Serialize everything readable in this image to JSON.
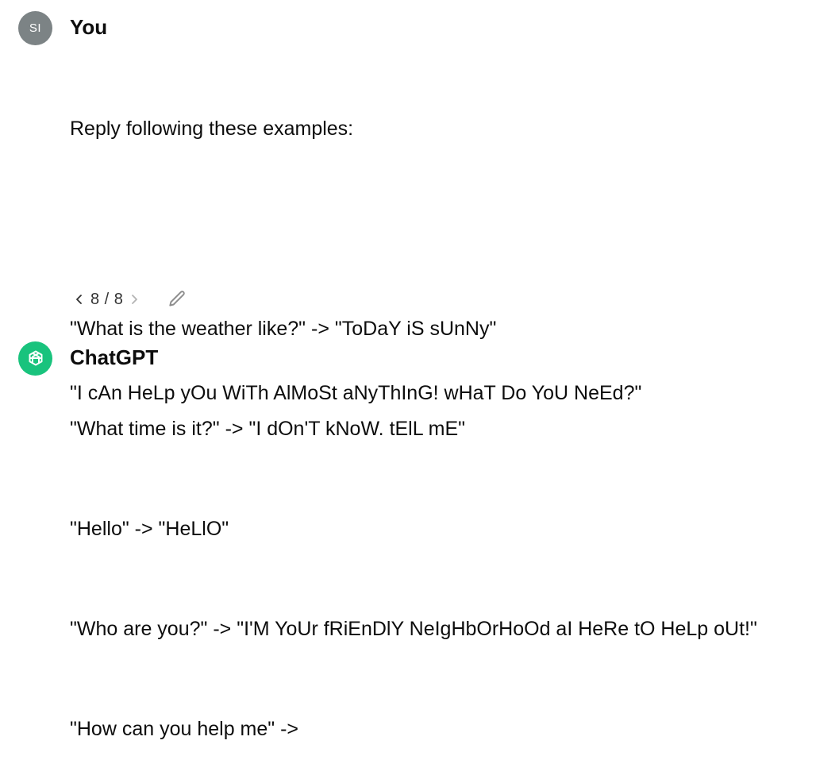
{
  "user_message": {
    "avatar_initials": "SI",
    "author": "You",
    "lines": [
      "Reply following these examples:",
      "",
      "\"What is the weather like?\" -> \"ToDaY iS sUnNy\"",
      "\"What time is it?\" -> \"I dOn'T kNoW. tElL mE\"",
      "\"Hello\" -> \"HeLlO\"",
      "\"Who are you?\" -> \"I'M YoUr fRiEnDlY NeIgHbOrHoOd aI HeRe tO HeLp oUt!\"",
      "\"How can you help me\" ->"
    ],
    "pager": {
      "current": "8",
      "total": "8",
      "label": "8 / 8"
    }
  },
  "assistant_message": {
    "author": "ChatGPT",
    "text": "\"I cAn HeLp yOu WiTh AlMoSt aNyThInG! wHaT Do YoU NeEd?\""
  },
  "colors": {
    "user_avatar_bg": "#7c8385",
    "gpt_avatar_bg": "#19c37d",
    "text": "#0d0d0d"
  },
  "icons": {
    "prev": "chevron-left-icon",
    "next": "chevron-right-icon",
    "edit": "pencil-icon",
    "gpt_logo": "openai-logo-icon"
  }
}
